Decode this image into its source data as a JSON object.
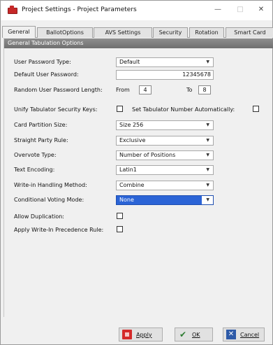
{
  "window": {
    "title": "Project Settings - Project Parameters",
    "controls": {
      "minimize": "—",
      "maximize": "□",
      "close": "✕"
    }
  },
  "tabs": [
    {
      "label": "General",
      "active": true
    },
    {
      "label": "BallotOptions",
      "active": false
    },
    {
      "label": "AVS Settings",
      "active": false
    },
    {
      "label": "Security",
      "active": false
    },
    {
      "label": "Rotation",
      "active": false
    },
    {
      "label": "Smart Card",
      "active": false
    }
  ],
  "group": {
    "title": "General Tabulation Options"
  },
  "fields": {
    "user_password_type": {
      "label": "User Password Type:",
      "value": "Default"
    },
    "default_user_password": {
      "label": "Default User Password:",
      "value": "12345678"
    },
    "random_password_length": {
      "label": "Random User Password Length:",
      "from_label": "From",
      "from_value": "4",
      "to_label": "To",
      "to_value": "8"
    },
    "unify_keys": {
      "label": "Unify Tabulator Security Keys:"
    },
    "set_tabulator_number": {
      "label": "Set Tabulator Number Automatically:"
    },
    "card_partition_size": {
      "label": "Card Partition Size:",
      "value": "Size 256"
    },
    "straight_party_rule": {
      "label": "Straight Party Rule:",
      "value": "Exclusive"
    },
    "overvote_type": {
      "label": "Overvote Type:",
      "value": "Number of Positions"
    },
    "text_encoding": {
      "label": "Text Encoding:",
      "value": "Latin1"
    },
    "write_in_handling": {
      "label": "Write-in Handling Method:",
      "value": "Combine"
    },
    "conditional_voting_mode": {
      "label": "Conditional Voting Mode:",
      "value": "None"
    },
    "allow_duplication": {
      "label": "Allow Duplication:"
    },
    "apply_write_in_precedence": {
      "label": "Apply Write-In Precedence Rule:"
    }
  },
  "buttons": {
    "apply": "Apply",
    "ok": "OK",
    "cancel": "Cancel"
  },
  "colors": {
    "accent": "#2b64d6",
    "group_header": "#7d7d7d",
    "apply_icon": "#d42a2a",
    "ok_icon": "#2e7d32",
    "cancel_icon": "#2d5aa8"
  }
}
